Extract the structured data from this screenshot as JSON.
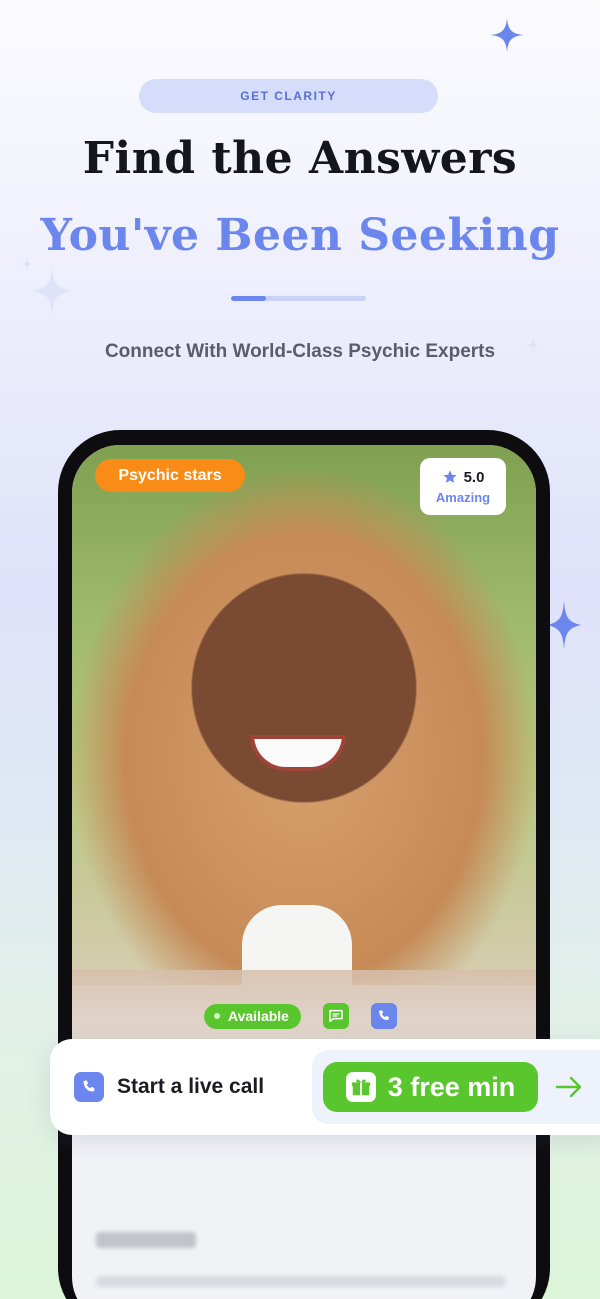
{
  "header": {
    "eyebrow": "GET CLARITY",
    "title_line1": "Find the Answers",
    "title_line2": "You've Been Seeking",
    "subtitle": "Connect With World-Class Psychic Experts",
    "divider_progress": 0.26
  },
  "profile": {
    "badge": "Psychic stars",
    "rating": "5.0",
    "rating_label": "Amazing",
    "status": "Available",
    "icons": [
      "star-icon",
      "chat-icon",
      "phone-icon"
    ]
  },
  "cta": {
    "label": "Start a live call",
    "offer": "3 free min",
    "icons": [
      "phone-icon",
      "gift-icon",
      "arrow-right-icon"
    ]
  },
  "colors": {
    "accent_blue": "#6b86ec",
    "accent_green": "#5ac62e",
    "badge_orange": "#f98b17",
    "title_dark": "#15161c"
  }
}
